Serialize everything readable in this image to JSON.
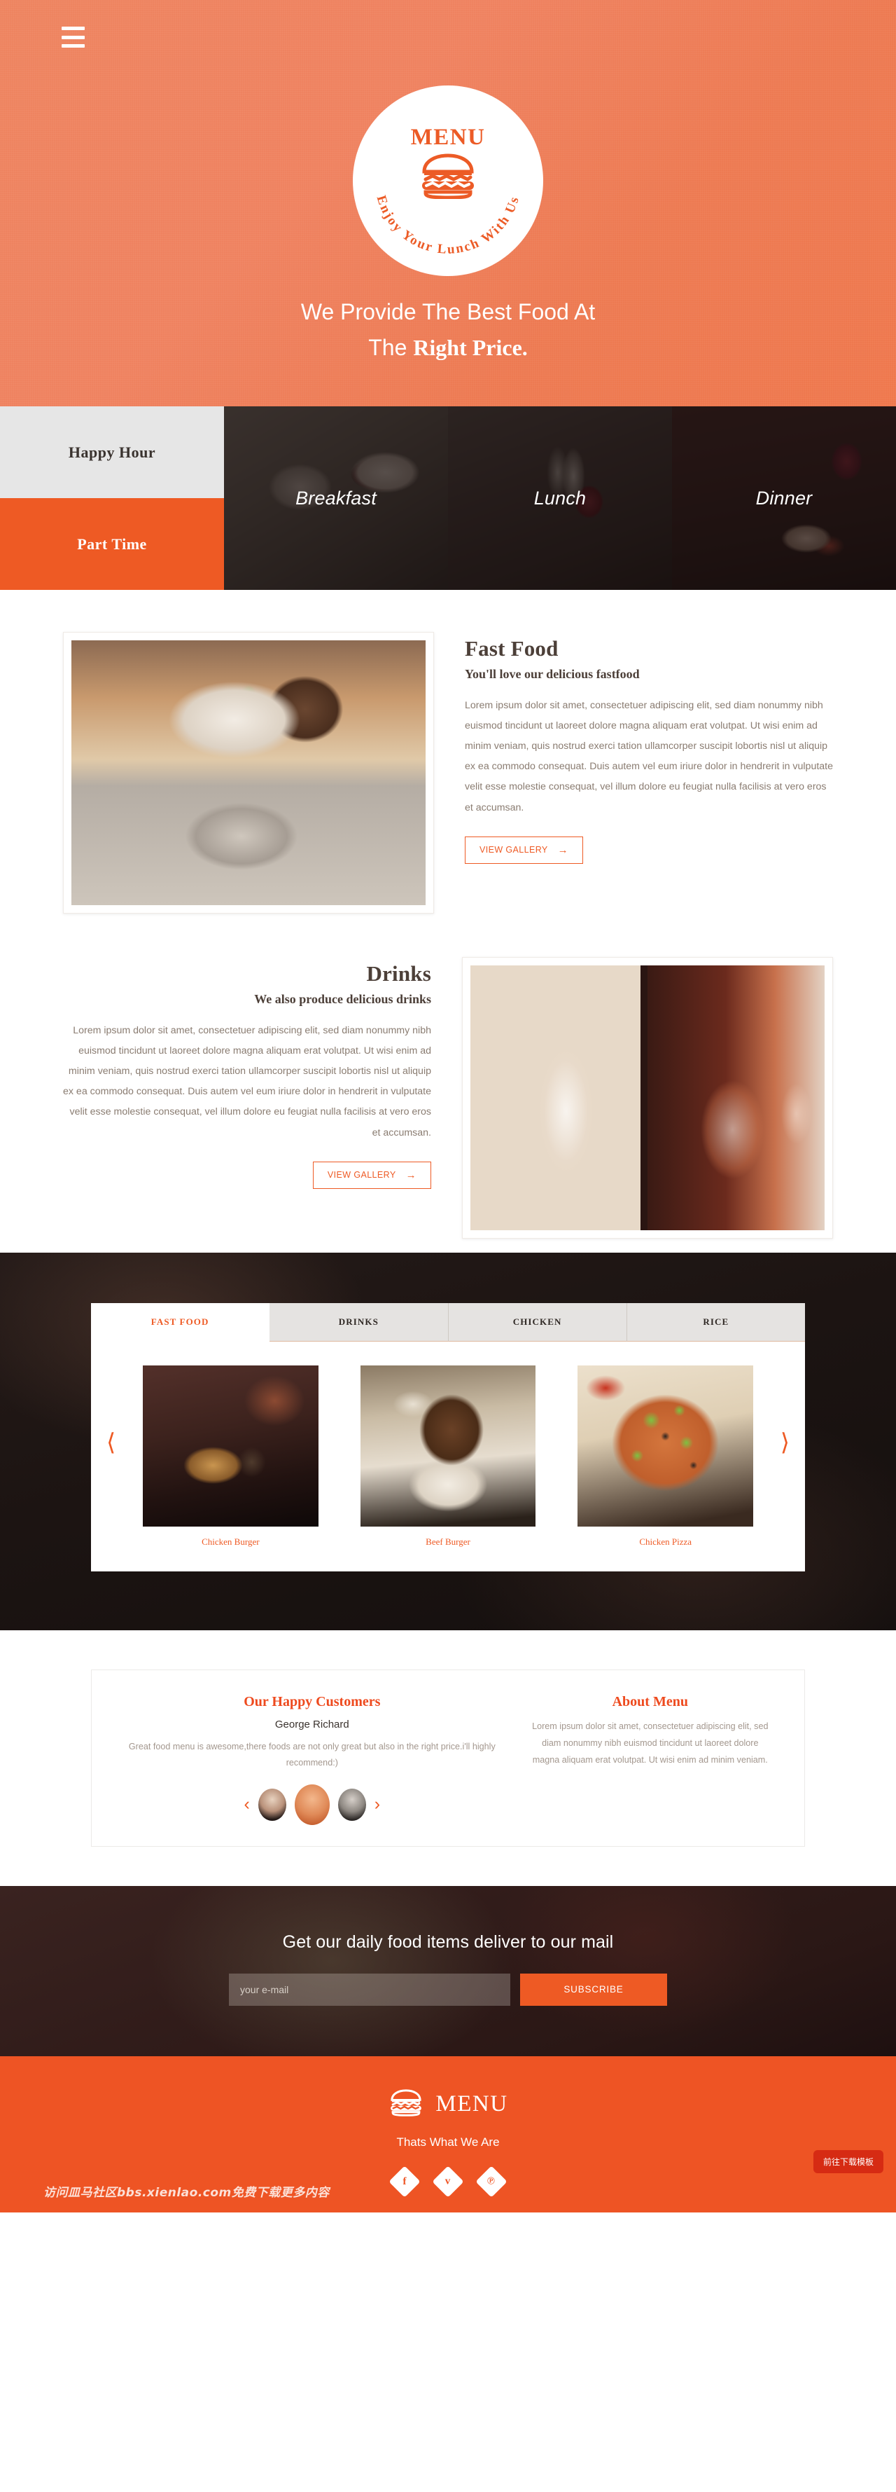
{
  "hero": {
    "menu_icon": "hamburger-menu-icon",
    "logo": {
      "word": "MENU",
      "tagline": "Enjoy Your Lunch With Us",
      "icon": "burger-icon"
    },
    "title_line1": "We Provide The Best Food At",
    "title_line2_plain": "The ",
    "title_line2_highlight": "Right Price."
  },
  "meal_strip": {
    "side_tabs": [
      {
        "label": "Happy Hour",
        "active": false
      },
      {
        "label": "Part Time",
        "active": true
      }
    ],
    "image_tabs": [
      {
        "label": "Breakfast"
      },
      {
        "label": "Lunch"
      },
      {
        "label": "Dinner"
      }
    ]
  },
  "sections": [
    {
      "title": "Fast Food",
      "subtitle": "You'll love our delicious fastfood",
      "body": "Lorem ipsum dolor sit amet, consectetuer adipiscing elit, sed diam nonummy nibh euismod tincidunt ut laoreet dolore magna aliquam erat volutpat. Ut wisi enim ad minim veniam, quis nostrud exerci tation ullamcorper suscipit lobortis nisl ut aliquip ex ea commodo consequat. Duis autem vel eum iriure dolor in hendrerit in vulputate velit esse molestie consequat, vel illum dolore eu feugiat nulla facilisis at vero eros et accumsan.",
      "button": "VIEW GALLERY",
      "button_icon": "arrow-right-icon"
    },
    {
      "title": "Drinks",
      "subtitle": "We also produce delicious drinks",
      "body": "Lorem ipsum dolor sit amet, consectetuer adipiscing elit, sed diam nonummy nibh euismod tincidunt ut laoreet dolore magna aliquam erat volutpat. Ut wisi enim ad minim veniam, quis nostrud exerci tation ullamcorper suscipit lobortis nisl ut aliquip ex ea commodo consequat. Duis autem vel eum iriure dolor in hendrerit in vulputate velit esse molestie consequat, vel illum dolore eu feugiat nulla facilisis at vero eros et accumsan.",
      "button": "VIEW GALLERY",
      "button_icon": "arrow-right-icon"
    }
  ],
  "gallery": {
    "tabs": [
      {
        "label": "FAST FOOD",
        "active": true
      },
      {
        "label": "DRINKS",
        "active": false
      },
      {
        "label": "CHICKEN",
        "active": false
      },
      {
        "label": "RICE",
        "active": false
      }
    ],
    "items": [
      {
        "caption": "Chicken Burger"
      },
      {
        "caption": "Beef Burger"
      },
      {
        "caption": "Chicken Pizza"
      }
    ],
    "prev_icon": "chevron-left-icon",
    "next_icon": "chevron-right-icon"
  },
  "testimonials": {
    "heading": "Our Happy Customers",
    "name": "George Richard",
    "quote": "Great food menu is awesome,there foods are not only great but also in the right price.i'll highly recommend:)",
    "prev_icon": "chevron-left-icon",
    "next_icon": "chevron-right-icon",
    "about": {
      "heading": "About Menu",
      "body": "Lorem ipsum dolor sit amet, consectetuer adipiscing elit, sed diam nonummy nibh euismod tincidunt ut laoreet dolore magna aliquam erat volutpat. Ut wisi enim ad minim veniam."
    }
  },
  "newsletter": {
    "heading": "Get our daily food items deliver to our mail",
    "placeholder": "your e-mail",
    "value": "",
    "button": "SUBSCRIBE"
  },
  "footer": {
    "brand": "MENU",
    "brand_icon": "burger-icon",
    "tagline": "Thats What We Are",
    "socials": [
      {
        "name": "facebook-icon",
        "glyph": "f"
      },
      {
        "name": "twitter-icon",
        "glyph": "ᴠ"
      },
      {
        "name": "pinterest-icon",
        "glyph": "℗"
      }
    ],
    "watermark": "访问皿马社区bbs.xienlao.com免费下载更多内容",
    "download_badge": "前往下载模板"
  },
  "colors": {
    "accent": "#ee5a24",
    "accent_dark": "#d62b13",
    "hero_gradient_start": "#ee8460",
    "hero_gradient_end": "#ef784d",
    "text_dark": "#4c3f38",
    "text_muted": "#8a7c71"
  }
}
